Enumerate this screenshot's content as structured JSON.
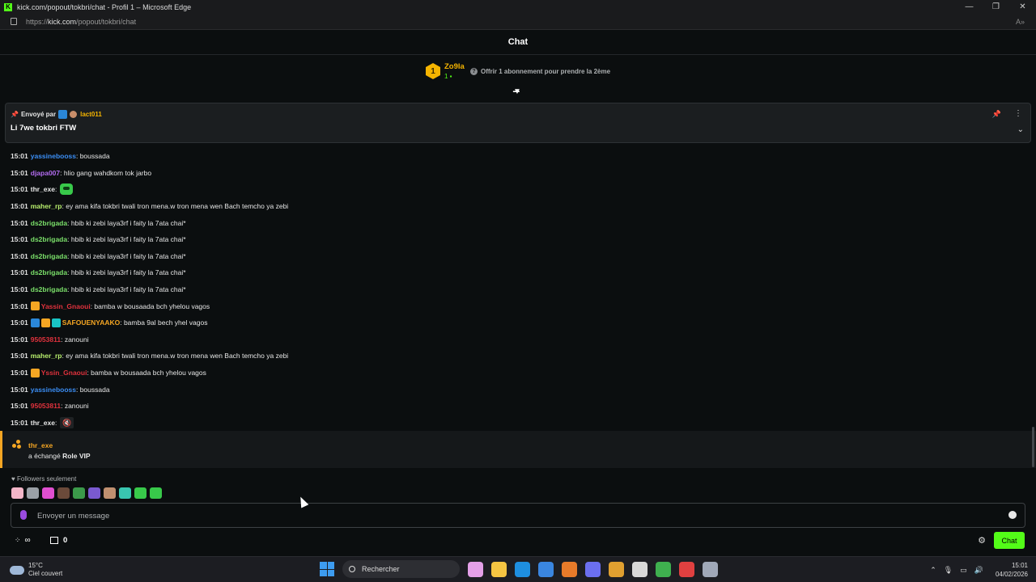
{
  "window": {
    "title": "kick.com/popout/tokbri/chat - Profil 1 – Microsoft Edge",
    "controls": [
      "minimize-icon",
      "restore-icon",
      "close-icon"
    ]
  },
  "address": {
    "prefix": "https://",
    "domain": "kick.com",
    "path": "/popout/tokbri/chat"
  },
  "header": {
    "title": "Chat"
  },
  "gift_banner": {
    "gifter_rank": "1",
    "gifter_name": "Zo9la",
    "gifter_count": "1",
    "offer_text": "Offrir 1 abonnement pour prendre la 2ème"
  },
  "pinned": {
    "sent_by_label": "Envoyé par",
    "user": "lact011",
    "message": "Li 7we tokbri FTW"
  },
  "messages": [
    {
      "time": "15:01",
      "user": "yassinebooss",
      "color": "#3b8ef5",
      "text": ": boussada"
    },
    {
      "time": "15:01",
      "user": "djapa007",
      "color": "#b36cf0",
      "text": ": hlio gang wahdkom tok jarbo"
    },
    {
      "time": "15:01",
      "user": "thr_exe",
      "color": "#e8e8e8",
      "text": ":",
      "emote": "green-face-emote"
    },
    {
      "time": "15:01",
      "user": "maher_rp",
      "color": "#b9f06e",
      "text": ": ey ama kifa tokbri twali tron mena.w tron mena wen Bach temcho ya zebi"
    },
    {
      "time": "15:01",
      "user": "ds2brigada",
      "color": "#7be06a",
      "text": ": hbib ki zebi laya3rf i faity la 7ata chai*"
    },
    {
      "time": "15:01",
      "user": "ds2brigada",
      "color": "#7be06a",
      "text": ": hbib ki zebi laya3rf i faity la 7ata chai*"
    },
    {
      "time": "15:01",
      "user": "ds2brigada",
      "color": "#7be06a",
      "text": ": hbib ki zebi laya3rf i faity la 7ata chai*"
    },
    {
      "time": "15:01",
      "user": "ds2brigada",
      "color": "#7be06a",
      "text": ": hbib ki zebi laya3rf i faity la 7ata chai*"
    },
    {
      "time": "15:01",
      "user": "ds2brigada",
      "color": "#7be06a",
      "text": ": hbib ki zebi laya3rf i faity la 7ata chai*"
    },
    {
      "time": "15:01",
      "user": "Yassin_Gnaoui",
      "color": "#e0323d",
      "text": ": bamba w bousaada bch yhelou vagos",
      "badges": [
        "gold"
      ]
    },
    {
      "time": "15:01",
      "user": "SAFOUENYAAKO",
      "color": "#f5a623",
      "text": ": bamba 9al bech yhel vagos",
      "badges": [
        "blue",
        "gold",
        "teal"
      ]
    },
    {
      "time": "15:01",
      "user": "95053811",
      "color": "#e0323d",
      "text": ": zanouni"
    },
    {
      "time": "15:01",
      "user": "maher_rp",
      "color": "#b9f06e",
      "text": ": ey ama kifa tokbri twali tron mena.w tron mena wen Bach temcho ya zebi"
    },
    {
      "time": "15:01",
      "user": "Yssin_Gnaoui",
      "color": "#e0323d",
      "text": ": bamba w bousaada bch yhelou vagos",
      "badges": [
        "gold"
      ]
    },
    {
      "time": "15:01",
      "user": "yassinebooss",
      "color": "#3b8ef5",
      "text": ": boussada"
    },
    {
      "time": "15:01",
      "user": "95053811",
      "color": "#e0323d",
      "text": ": zanouni"
    },
    {
      "time": "15:01",
      "user": "thr_exe",
      "color": "#e8e8e8",
      "text": ":",
      "emote": "mute-emote"
    }
  ],
  "reward": {
    "user": "thr_exe",
    "text_prefix": "a échangé",
    "reward_name": "Role VIP"
  },
  "followers_only": "Followers seulement",
  "recent_emotes": [
    "#f3b6c8",
    "#9aa0a6",
    "#e04fd0",
    "#6b4a3a",
    "#3b9a4a",
    "#7a5ad0",
    "#c09070",
    "#39c6b0",
    "#38c94a",
    "#38c94a"
  ],
  "input": {
    "placeholder": "Envoyer un message"
  },
  "bottom": {
    "points": "∞",
    "store_count": "0",
    "chat_button": "Chat"
  },
  "colors": {
    "accent": "#53fc18",
    "gold": "#f5b400"
  },
  "taskbar": {
    "temperature": "15°C",
    "weather": "Ciel couvert",
    "search_label": "Rechercher",
    "time": "15:01",
    "date": "04/02/2026",
    "app_icons": [
      "#e4a0e8",
      "#f5c542",
      "#1e8fe0",
      "#3a86e0",
      "#e87b2a",
      "#6b6ff0",
      "#e0a030",
      "#d8d8d8",
      "#3fb04f",
      "#e04040",
      "#a0a8b8"
    ]
  }
}
